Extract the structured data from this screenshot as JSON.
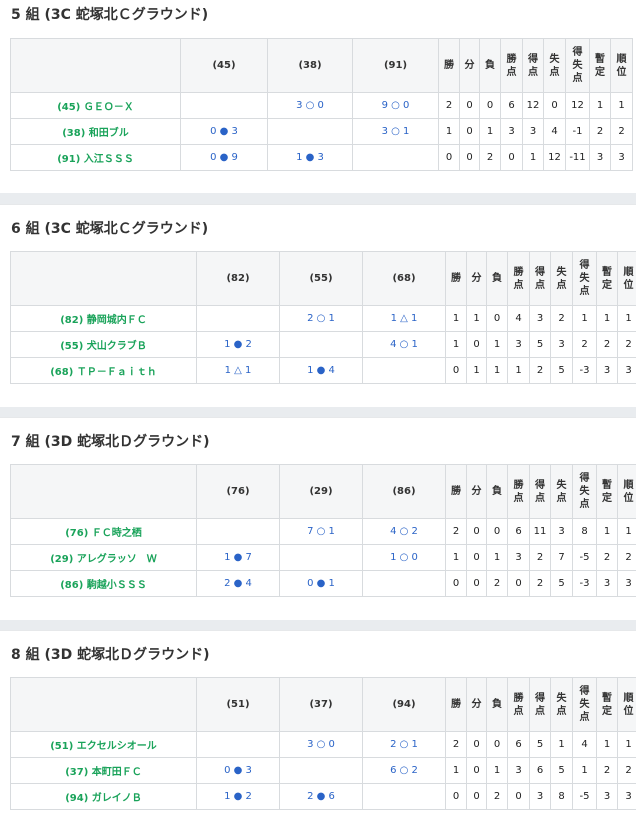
{
  "stat_headers": [
    {
      "key": "wins",
      "chars": [
        "勝"
      ]
    },
    {
      "key": "draws",
      "chars": [
        "分"
      ]
    },
    {
      "key": "losses",
      "chars": [
        "負"
      ]
    },
    {
      "key": "points",
      "chars": [
        "勝",
        "点"
      ]
    },
    {
      "key": "goals_for",
      "chars": [
        "得",
        "点"
      ]
    },
    {
      "key": "goals_against",
      "chars": [
        "失",
        "点"
      ]
    },
    {
      "key": "goal_diff",
      "chars": [
        "得",
        "失",
        "点"
      ]
    },
    {
      "key": "provisional",
      "chars": [
        "暫",
        "定"
      ]
    },
    {
      "key": "rank",
      "chars": [
        "順",
        "位"
      ]
    }
  ],
  "groups": [
    {
      "title": "5 組 (3C 蛇塚北Ｃグラウンド)",
      "columns": [
        "(45)",
        "(38)",
        "(91)"
      ],
      "rows": [
        {
          "team": "(45) ＧＥＯ－Ｘ",
          "results": [
            "",
            "3 ○ 0",
            "9 ○ 0"
          ],
          "stats": [
            "2",
            "0",
            "0",
            "6",
            "12",
            "0",
            "12",
            "1",
            "1"
          ]
        },
        {
          "team": "(38) 和田ブル",
          "results": [
            "0 ● 3",
            "",
            "3 ○ 1"
          ],
          "stats": [
            "1",
            "0",
            "1",
            "3",
            "3",
            "4",
            "-1",
            "2",
            "2"
          ]
        },
        {
          "team": "(91) 入江ＳＳＳ",
          "results": [
            "0 ● 9",
            "1 ● 3",
            ""
          ],
          "stats": [
            "0",
            "0",
            "2",
            "0",
            "1",
            "12",
            "-11",
            "3",
            "3"
          ]
        }
      ]
    },
    {
      "title": "6 組 (3C 蛇塚北Ｃグラウンド)",
      "columns": [
        "(82)",
        "(55)",
        "(68)"
      ],
      "rows": [
        {
          "team": "(82) 静岡城内ＦＣ",
          "results": [
            "",
            "2 ○ 1",
            "1 △ 1"
          ],
          "stats": [
            "1",
            "1",
            "0",
            "4",
            "3",
            "2",
            "1",
            "1",
            "1"
          ]
        },
        {
          "team": "(55) 犬山クラブＢ",
          "results": [
            "1 ● 2",
            "",
            "4 ○ 1"
          ],
          "stats": [
            "1",
            "0",
            "1",
            "3",
            "5",
            "3",
            "2",
            "2",
            "2"
          ]
        },
        {
          "team": "(68) ＴＰ－Ｆａｉｔｈ",
          "results": [
            "1 △ 1",
            "1 ● 4",
            ""
          ],
          "stats": [
            "0",
            "1",
            "1",
            "1",
            "2",
            "5",
            "-3",
            "3",
            "3"
          ]
        }
      ]
    },
    {
      "title": "7 組 (3D 蛇塚北Ｄグラウンド)",
      "columns": [
        "(76)",
        "(29)",
        "(86)"
      ],
      "rows": [
        {
          "team": "(76) ＦＣ時之栖",
          "results": [
            "",
            "7 ○ 1",
            "4 ○ 2"
          ],
          "stats": [
            "2",
            "0",
            "0",
            "6",
            "11",
            "3",
            "8",
            "1",
            "1"
          ]
        },
        {
          "team": "(29) アレグラッソ　Ｗ",
          "results": [
            "1 ● 7",
            "",
            "1 ○ 0"
          ],
          "stats": [
            "1",
            "0",
            "1",
            "3",
            "2",
            "7",
            "-5",
            "2",
            "2"
          ]
        },
        {
          "team": "(86) 駒越小ＳＳＳ",
          "results": [
            "2 ● 4",
            "0 ● 1",
            ""
          ],
          "stats": [
            "0",
            "0",
            "2",
            "0",
            "2",
            "5",
            "-3",
            "3",
            "3"
          ]
        }
      ]
    },
    {
      "title": "8 組 (3D 蛇塚北Ｄグラウンド)",
      "columns": [
        "(51)",
        "(37)",
        "(94)"
      ],
      "rows": [
        {
          "team": "(51) エクセルシオール",
          "results": [
            "",
            "3 ○ 0",
            "2 ○ 1"
          ],
          "stats": [
            "2",
            "0",
            "0",
            "6",
            "5",
            "1",
            "4",
            "1",
            "1"
          ]
        },
        {
          "team": "(37) 本町田ＦＣ",
          "results": [
            "0 ● 3",
            "",
            "6 ○ 2"
          ],
          "stats": [
            "1",
            "0",
            "1",
            "3",
            "6",
            "5",
            "1",
            "2",
            "2"
          ]
        },
        {
          "team": "(94) ガレイノＢ",
          "results": [
            "1 ● 2",
            "2 ● 6",
            ""
          ],
          "stats": [
            "0",
            "0",
            "2",
            "0",
            "3",
            "8",
            "-5",
            "3",
            "3"
          ]
        }
      ]
    }
  ]
}
